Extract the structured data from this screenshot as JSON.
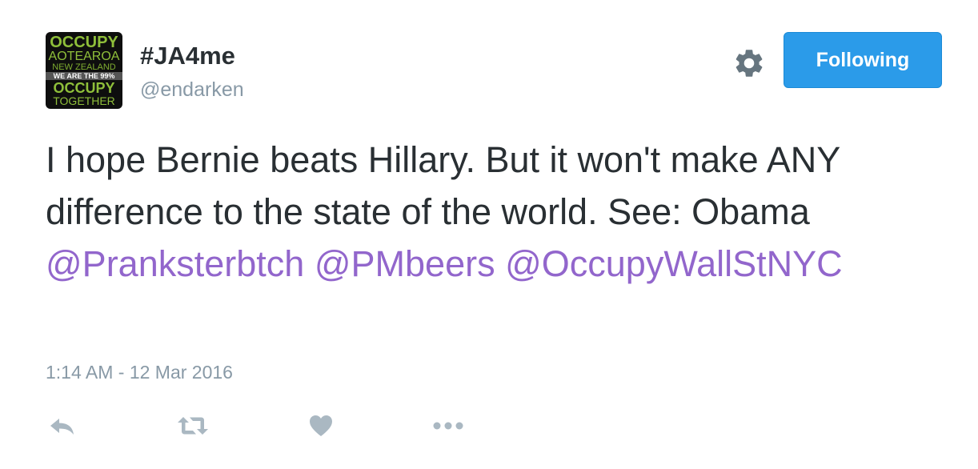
{
  "author": {
    "display_name": "#JA4me",
    "handle": "@endarken",
    "avatar_text": [
      "OCCUPY",
      "AOTEAROA",
      "NEW ZEALAND",
      "WE ARE THE 99%",
      "OCCUPY",
      "TOGETHER"
    ]
  },
  "header": {
    "settings_icon": "gear-icon",
    "follow_button_label": "Following",
    "follow_button_color": "#2b9be9"
  },
  "tweet": {
    "text_1": "I hope Bernie beats Hillary. But it won't make ANY difference to the state of the world. See: Obama ",
    "mentions": [
      "@Pranksterbtch",
      "@PMbeers",
      "@OccupyWallStNYC"
    ],
    "mention_color": "#9266cc",
    "timestamp": "1:14 AM - 12 Mar 2016"
  },
  "actions": [
    {
      "name": "reply",
      "icon": "reply-icon"
    },
    {
      "name": "retweet",
      "icon": "retweet-icon"
    },
    {
      "name": "like",
      "icon": "heart-icon"
    },
    {
      "name": "more",
      "icon": "more-icon"
    }
  ]
}
